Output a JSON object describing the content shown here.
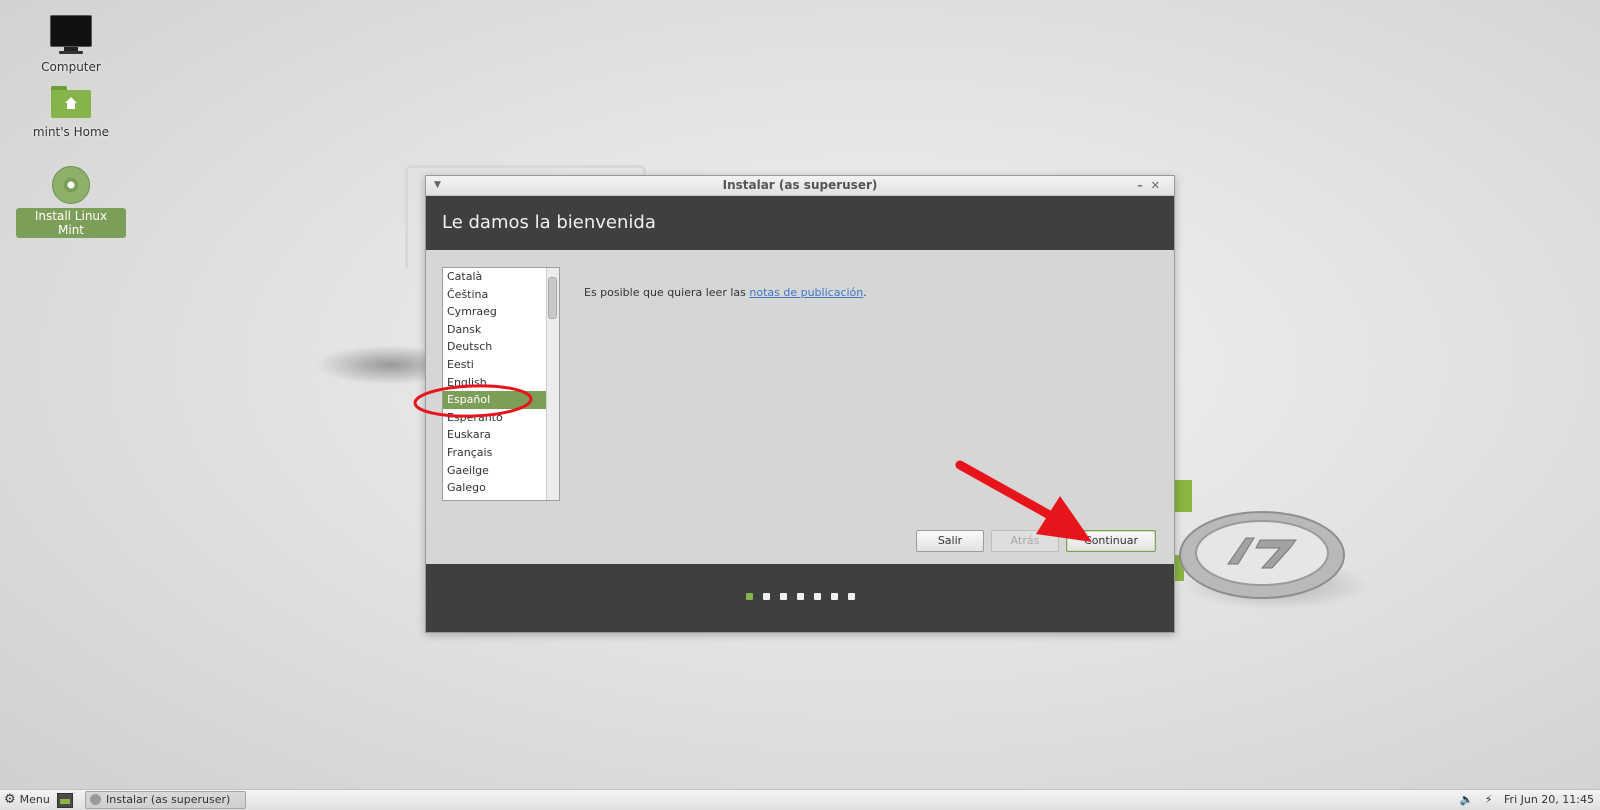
{
  "desktop": {
    "icons": [
      {
        "label": "Computer"
      },
      {
        "label": "mint's Home"
      },
      {
        "label": "Install Linux Mint"
      }
    ]
  },
  "window": {
    "title": "Instalar (as superuser)",
    "heading": "Le damos la bienvenida",
    "languages": [
      "Català",
      "Čeština",
      "Cymraeg",
      "Dansk",
      "Deutsch",
      "Eesti",
      "English",
      "Español",
      "Esperanto",
      "Euskara",
      "Français",
      "Gaeilge",
      "Galego"
    ],
    "selected_language": "Español",
    "notes_prefix": "Es posible que quiera leer las ",
    "notes_link": "notas de publicación",
    "notes_suffix": ".",
    "buttons": {
      "quit": "Salir",
      "back": "Atrás",
      "continue": "Continuar"
    },
    "progress": {
      "total_steps": 7,
      "current_step": 1
    }
  },
  "taskbar": {
    "menu_label": "Menu",
    "task_label": "Instalar (as superuser)",
    "clock": "Fri Jun 20, 11:45"
  },
  "colors": {
    "accent": "#7d9e59",
    "header_bg": "#3f3f3f",
    "annotation": "#e8141b"
  }
}
